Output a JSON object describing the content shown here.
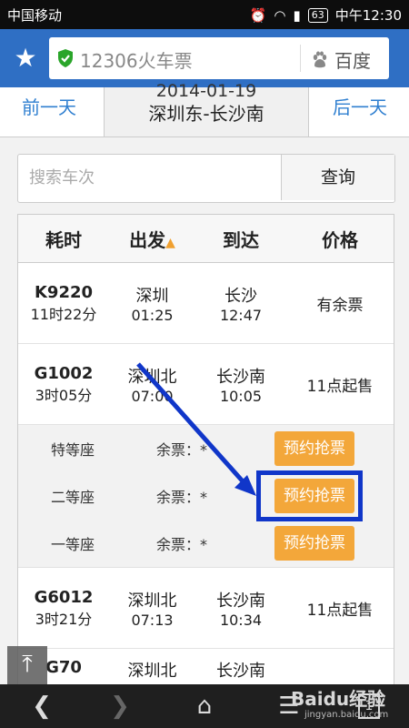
{
  "status_bar": {
    "carrier": "中国移动",
    "battery": "63",
    "time": "中午12:30"
  },
  "browser": {
    "url": "12306火车票",
    "search_engine": "百度"
  },
  "date_nav": {
    "prev": "前一天",
    "date": "2014-01-19",
    "route": "深圳东-长沙南",
    "next": "后一天"
  },
  "search": {
    "placeholder": "搜索车次",
    "button": "查询"
  },
  "table": {
    "headers": [
      "耗时",
      "出发",
      "到达",
      "价格"
    ],
    "sort_indicator": "▲",
    "rows": [
      {
        "train": "K9220",
        "duration": "11时22分",
        "from": "深圳",
        "depart": "01:25",
        "to": "长沙",
        "arrive": "12:47",
        "price": "有余票"
      },
      {
        "train": "G1002",
        "duration": "3时05分",
        "from": "深圳北",
        "depart": "07:00",
        "to": "长沙南",
        "arrive": "10:05",
        "price": "11点起售"
      },
      {
        "train": "G6012",
        "duration": "3时21分",
        "from": "深圳北",
        "depart": "07:13",
        "to": "长沙南",
        "arrive": "10:34",
        "price": "11点起售"
      },
      {
        "train": "G70",
        "duration": "",
        "from": "深圳北",
        "depart": "",
        "to": "长沙南",
        "arrive": "",
        "price": ""
      }
    ],
    "seats": [
      {
        "name": "特等座",
        "remain": "余票：*",
        "action": "预约抢票"
      },
      {
        "name": "二等座",
        "remain": "余票：*",
        "action": "预约抢票"
      },
      {
        "name": "一等座",
        "remain": "余票：*",
        "action": "预约抢票"
      }
    ]
  },
  "watermark": {
    "text": "Baidu经验",
    "url": "jingyan.baidu.com"
  },
  "colors": {
    "accent": "#2f6fc4",
    "button": "#f3a73a",
    "highlight": "#1036c9"
  }
}
